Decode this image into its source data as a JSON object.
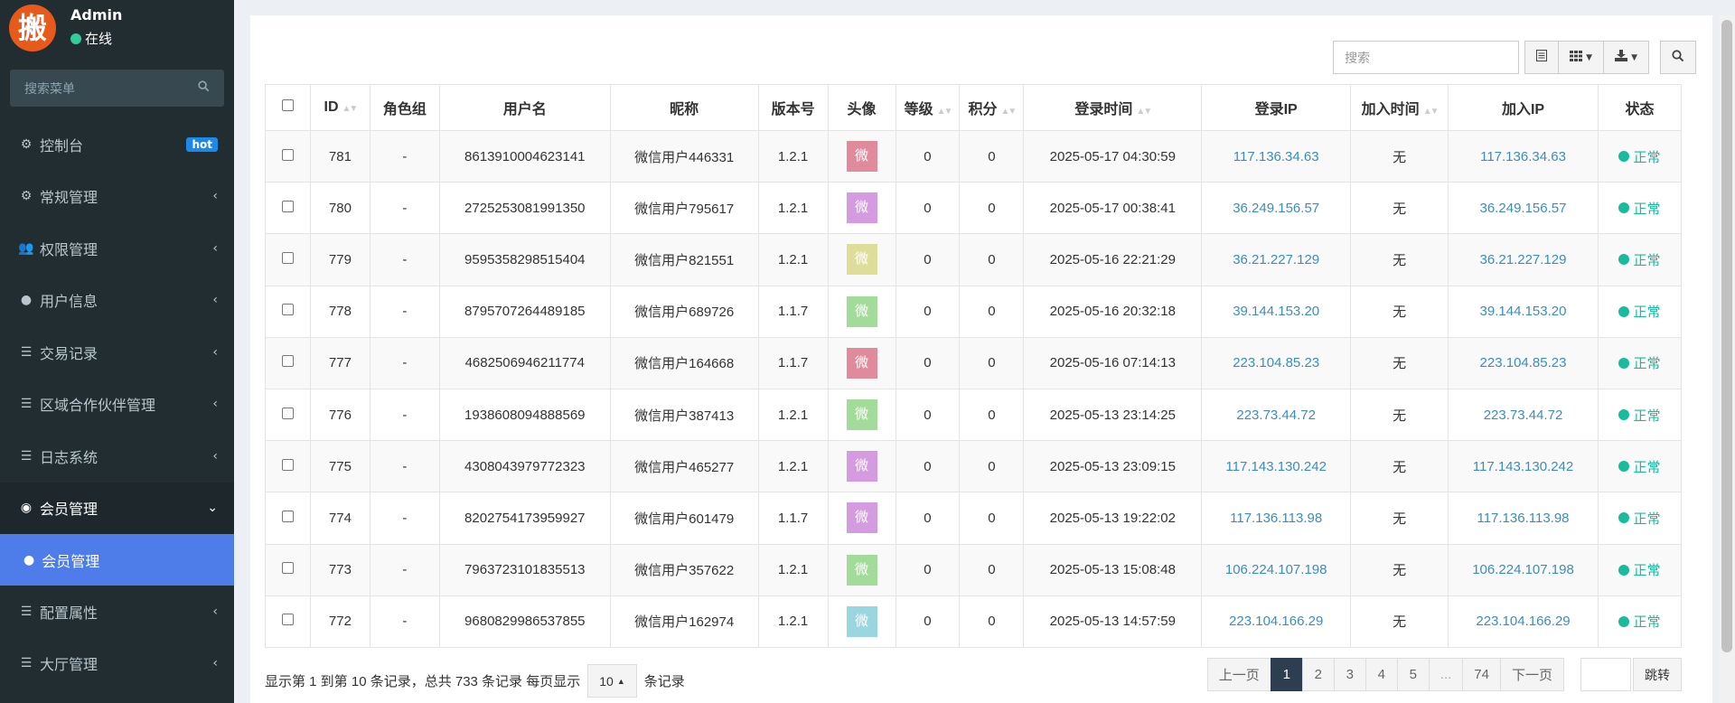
{
  "sidebar": {
    "avatar_char": "搬",
    "user_name": "Admin",
    "user_status": "在线",
    "search_placeholder": "搜索菜单",
    "items": [
      {
        "label": "控制台",
        "icon": "dashboard-icon",
        "glyph": "⚙",
        "badge": "hot"
      },
      {
        "label": "常规管理",
        "icon": "cogs-icon",
        "glyph": "⚙"
      },
      {
        "label": "权限管理",
        "icon": "group-icon",
        "glyph": "👥"
      },
      {
        "label": "用户信息",
        "icon": "user-icon",
        "glyph": "●"
      },
      {
        "label": "交易记录",
        "icon": "list-icon",
        "glyph": "☰"
      },
      {
        "label": "区域合作伙伴管理",
        "icon": "list-icon",
        "glyph": "☰"
      },
      {
        "label": "日志系统",
        "icon": "list-icon",
        "glyph": "☰"
      },
      {
        "label": "会员管理",
        "icon": "user-circle-icon",
        "glyph": "◉"
      },
      {
        "label": "会员管理",
        "icon": "user-icon",
        "glyph": "●"
      },
      {
        "label": "配置属性",
        "icon": "list-icon",
        "glyph": "☰"
      },
      {
        "label": "大厅管理",
        "icon": "list-icon",
        "glyph": "☰"
      }
    ]
  },
  "toolbar": {
    "search_placeholder": "搜索"
  },
  "table": {
    "headers": [
      "ID",
      "角色组",
      "用户名",
      "昵称",
      "版本号",
      "头像",
      "等级",
      "积分",
      "登录时间",
      "登录IP",
      "加入时间",
      "加入IP",
      "状态"
    ],
    "avatar_char": "微",
    "rows": [
      {
        "id": "781",
        "group": "-",
        "username": "8613910004623141",
        "nickname": "微信用户446331",
        "version": "1.2.1",
        "avatar_color": "#e08a9b",
        "level": "0",
        "score": "0",
        "login_time": "2025-05-17 04:30:59",
        "login_ip": "117.136.34.63",
        "join_time": "无",
        "join_ip": "117.136.34.63",
        "status": "正常"
      },
      {
        "id": "780",
        "group": "-",
        "username": "2725253081991350",
        "nickname": "微信用户795617",
        "version": "1.2.1",
        "avatar_color": "#d49be0",
        "level": "0",
        "score": "0",
        "login_time": "2025-05-17 00:38:41",
        "login_ip": "36.249.156.57",
        "join_time": "无",
        "join_ip": "36.249.156.57",
        "status": "正常"
      },
      {
        "id": "779",
        "group": "-",
        "username": "9595358298515404",
        "nickname": "微信用户821551",
        "version": "1.2.1",
        "avatar_color": "#dede9a",
        "level": "0",
        "score": "0",
        "login_time": "2025-05-16 22:21:29",
        "login_ip": "36.21.227.129",
        "join_time": "无",
        "join_ip": "36.21.227.129",
        "status": "正常"
      },
      {
        "id": "778",
        "group": "-",
        "username": "8795707264489185",
        "nickname": "微信用户689726",
        "version": "1.1.7",
        "avatar_color": "#a3dc9a",
        "level": "0",
        "score": "0",
        "login_time": "2025-05-16 20:32:18",
        "login_ip": "39.144.153.20",
        "join_time": "无",
        "join_ip": "39.144.153.20",
        "status": "正常"
      },
      {
        "id": "777",
        "group": "-",
        "username": "4682506946211774",
        "nickname": "微信用户164668",
        "version": "1.1.7",
        "avatar_color": "#e08a9b",
        "level": "0",
        "score": "0",
        "login_time": "2025-05-16 07:14:13",
        "login_ip": "223.104.85.23",
        "join_time": "无",
        "join_ip": "223.104.85.23",
        "status": "正常"
      },
      {
        "id": "776",
        "group": "-",
        "username": "1938608094888569",
        "nickname": "微信用户387413",
        "version": "1.2.1",
        "avatar_color": "#a3dc9a",
        "level": "0",
        "score": "0",
        "login_time": "2025-05-13 23:14:25",
        "login_ip": "223.73.44.72",
        "join_time": "无",
        "join_ip": "223.73.44.72",
        "status": "正常"
      },
      {
        "id": "775",
        "group": "-",
        "username": "4308043979772323",
        "nickname": "微信用户465277",
        "version": "1.2.1",
        "avatar_color": "#d49be0",
        "level": "0",
        "score": "0",
        "login_time": "2025-05-13 23:09:15",
        "login_ip": "117.143.130.242",
        "join_time": "无",
        "join_ip": "117.143.130.242",
        "status": "正常"
      },
      {
        "id": "774",
        "group": "-",
        "username": "8202754173959927",
        "nickname": "微信用户601479",
        "version": "1.1.7",
        "avatar_color": "#d49be0",
        "level": "0",
        "score": "0",
        "login_time": "2025-05-13 19:22:02",
        "login_ip": "117.136.113.98",
        "join_time": "无",
        "join_ip": "117.136.113.98",
        "status": "正常"
      },
      {
        "id": "773",
        "group": "-",
        "username": "7963723101835513",
        "nickname": "微信用户357622",
        "version": "1.2.1",
        "avatar_color": "#a3dc9a",
        "level": "0",
        "score": "0",
        "login_time": "2025-05-13 15:08:48",
        "login_ip": "106.224.107.198",
        "join_time": "无",
        "join_ip": "106.224.107.198",
        "status": "正常"
      },
      {
        "id": "772",
        "group": "-",
        "username": "9680829986537855",
        "nickname": "微信用户162974",
        "version": "1.2.1",
        "avatar_color": "#9ad6e0",
        "level": "0",
        "score": "0",
        "login_time": "2025-05-13 14:57:59",
        "login_ip": "223.104.166.29",
        "join_time": "无",
        "join_ip": "223.104.166.29",
        "status": "正常"
      }
    ]
  },
  "footer": {
    "info_prefix": "显示第 1 到第 10 条记录，总共 733 条记录 每页显示",
    "page_size": "10",
    "info_suffix": "条记录",
    "prev": "上一页",
    "next": "下一页",
    "pages": [
      "1",
      "2",
      "3",
      "4",
      "5",
      "...",
      "74"
    ],
    "current_page": "1",
    "jump": "跳转"
  }
}
